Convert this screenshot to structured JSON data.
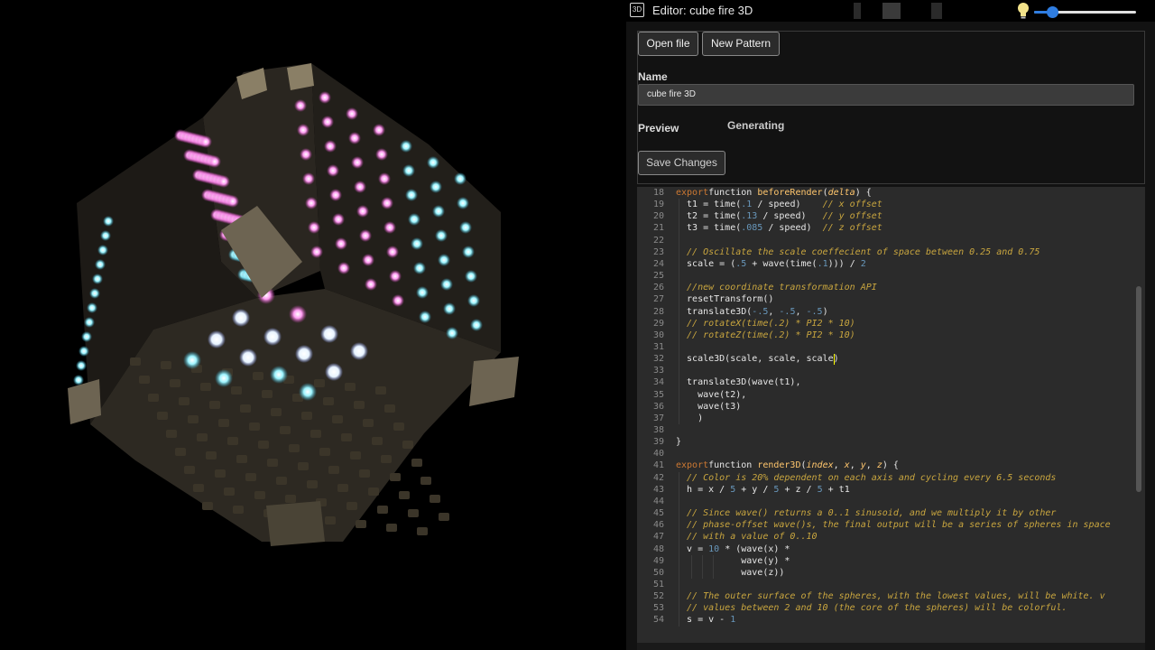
{
  "titlebar": {
    "app_icon_text": "3D",
    "title": "Editor: cube fire 3D",
    "bulb_icon": "lightbulb-icon",
    "brightness_fraction": 0.18
  },
  "toolbar": {
    "open_file_label": "Open file",
    "new_pattern_label": "New Pattern"
  },
  "form": {
    "name_label": "Name",
    "name_value": "cube fire 3D",
    "preview_label": "Preview",
    "preview_status": "Generating",
    "save_label": "Save Changes"
  },
  "code": {
    "line_numbers": [
      "18",
      "19",
      "20",
      "21",
      "22",
      "23",
      "24",
      "25",
      "26",
      "27",
      "28",
      "29",
      "30",
      "31",
      "32",
      "33",
      "34",
      "35",
      "36",
      "37",
      "38",
      "39",
      "40",
      "41",
      "42",
      "43",
      "44",
      "45",
      "46",
      "47",
      "48",
      "49",
      "50",
      "51",
      "52",
      "53",
      "54"
    ],
    "lines": [
      [
        [
          "kw",
          "export"
        ],
        [
          "",
          "function "
        ],
        [
          "fn",
          "beforeRender"
        ],
        [
          "",
          "("
        ],
        [
          "arg",
          "delta"
        ],
        [
          "",
          ") {"
        ]
      ],
      [
        [
          "",
          "  t1 = time("
        ],
        [
          "num",
          ".1"
        ],
        [
          "",
          ""
        ],
        [
          "",
          ""
        ],
        [
          "",
          ""
        ],
        [
          "",
          ""
        ],
        [
          "",
          ""
        ],
        [
          "",
          ""
        ],
        [
          "",
          ""
        ],
        [
          "",
          ""
        ],
        [
          "",
          ""
        ],
        [
          "",
          ""
        ],
        [
          "",
          ""
        ],
        [
          "",
          ""
        ],
        [
          "",
          ""
        ],
        [
          "",
          ""
        ],
        [
          "",
          ""
        ],
        [
          "",
          ""
        ],
        [
          "",
          ""
        ],
        [
          "",
          ""
        ],
        [
          "",
          ""
        ],
        [
          "",
          ""
        ],
        [
          "",
          ""
        ],
        [
          "",
          ""
        ],
        [
          "",
          ""
        ],
        [
          "",
          ""
        ],
        [
          "",
          ""
        ],
        [
          "",
          ""
        ],
        [
          "",
          ""
        ],
        [
          "",
          ""
        ],
        [
          "",
          ""
        ],
        [
          "",
          ""
        ],
        [
          "",
          ""
        ],
        [
          "",
          ""
        ],
        [
          "",
          ""
        ],
        [
          "",
          ""
        ],
        [
          "",
          ""
        ],
        [
          "",
          ""
        ],
        [
          "",
          ""
        ],
        [
          "",
          ""
        ],
        [
          "",
          ""
        ],
        [
          "",
          ""
        ],
        [
          "",
          ""
        ],
        [
          "",
          ""
        ],
        [
          "",
          ""
        ],
        [
          "",
          ""
        ],
        [
          "",
          ""
        ],
        [
          "",
          ""
        ],
        [
          "",
          ""
        ],
        [
          "",
          ""
        ],
        [
          "",
          ""
        ],
        [
          "",
          ""
        ],
        [
          "",
          ""
        ],
        [
          "",
          ""
        ],
        [
          "",
          ""
        ],
        [
          "",
          ""
        ],
        [
          "",
          ""
        ],
        [
          "",
          ""
        ],
        [
          "",
          ""
        ],
        [
          "",
          ""
        ],
        [
          "",
          ""
        ],
        [
          "",
          ""
        ],
        [
          "",
          ""
        ],
        [
          "",
          ""
        ],
        [
          "",
          ""
        ],
        [
          "",
          ""
        ],
        [
          "",
          ""
        ],
        [
          "",
          ""
        ],
        [
          "",
          ""
        ],
        [
          "",
          ""
        ],
        [
          "",
          ""
        ],
        [
          "",
          ""
        ],
        [
          "",
          ""
        ],
        [
          "",
          ""
        ],
        [
          "",
          ""
        ],
        [
          "",
          ""
        ],
        [
          "",
          ""
        ],
        [
          "",
          ""
        ],
        [
          "",
          ""
        ],
        [
          "",
          ""
        ],
        [
          "",
          ""
        ],
        [
          "",
          ""
        ],
        [
          "",
          ""
        ],
        [
          "",
          ""
        ],
        [
          "",
          ""
        ],
        [
          "",
          ""
        ],
        [
          "",
          ""
        ],
        [
          "",
          ""
        ],
        [
          "",
          ""
        ],
        [
          "",
          ""
        ],
        [
          "",
          ""
        ],
        [
          "",
          ""
        ],
        [
          "",
          ""
        ],
        [
          "",
          ""
        ],
        [
          "",
          ""
        ],
        [
          "",
          ""
        ],
        [
          "",
          ""
        ],
        [
          "",
          ""
        ],
        [
          "",
          ""
        ],
        [
          "",
          ""
        ],
        [
          "",
          ""
        ],
        [
          "",
          ""
        ],
        [
          "",
          ""
        ],
        [
          "",
          ""
        ],
        [
          "",
          ""
        ],
        [
          "",
          ""
        ],
        [
          "",
          ""
        ],
        [
          "",
          ""
        ],
        [
          "",
          " / speed)    "
        ],
        [
          "cm",
          "// x offset"
        ]
      ],
      [
        [
          "",
          "  t2 = time("
        ],
        [
          "num",
          ".13"
        ],
        [
          "",
          " / speed)   "
        ],
        [
          "cm",
          "// y offset"
        ]
      ],
      [
        [
          "",
          "  t3 = time("
        ],
        [
          "num",
          ".085"
        ],
        [
          "",
          " / speed)  "
        ],
        [
          "cm",
          "// z offset"
        ]
      ],
      [],
      [
        [
          "cm",
          "  // Oscillate the scale coeffecient of space between 0.25 and 0.75"
        ]
      ],
      [
        [
          "",
          "  scale = ("
        ],
        [
          "num",
          ".5"
        ],
        [
          "",
          " + wave(time("
        ],
        [
          "num",
          ".1"
        ],
        [
          "",
          "))) / "
        ],
        [
          "num",
          "2"
        ]
      ],
      [],
      [
        [
          "cm",
          "  //new coordinate transformation API"
        ]
      ],
      [
        [
          "",
          "  resetTransform()"
        ]
      ],
      [
        [
          "",
          "  translate3D("
        ],
        [
          "num",
          "-.5"
        ],
        [
          "",
          ", "
        ],
        [
          "num",
          "-.5"
        ],
        [
          "",
          ", "
        ],
        [
          "num",
          "-.5"
        ],
        [
          "",
          ")"
        ]
      ],
      [
        [
          "cm",
          "  // rotateX(time(.2) * PI2 * 10)"
        ]
      ],
      [
        [
          "cm",
          "  // rotateZ(time(.2) * PI2 * 10)"
        ]
      ],
      [],
      [
        [
          "",
          "  scale3D(scale, scale, scale)"
        ]
      ],
      [],
      [
        [
          "",
          "  translate3D(wave(t1),"
        ]
      ],
      [
        [
          "",
          "    wave(t2),"
        ]
      ],
      [
        [
          "",
          "    wave(t3)"
        ]
      ],
      [
        [
          "",
          "    )"
        ]
      ],
      [],
      [
        [
          "",
          "}"
        ]
      ],
      [],
      [
        [
          "kw",
          "export"
        ],
        [
          "",
          "function "
        ],
        [
          "fn",
          "render3D"
        ],
        [
          "",
          "("
        ],
        [
          "arg",
          "index"
        ],
        [
          "",
          ", "
        ],
        [
          "arg",
          "x"
        ],
        [
          "",
          ", "
        ],
        [
          "arg",
          "y"
        ],
        [
          "",
          ", "
        ],
        [
          "arg",
          "z"
        ],
        [
          "",
          ") {"
        ]
      ],
      [
        [
          "cm",
          "  // Color is 20% dependent on each axis and cycling every 6.5 seconds"
        ]
      ],
      [
        [
          "",
          "  h = x / "
        ],
        [
          "num",
          "5"
        ],
        [
          "",
          " + y / "
        ],
        [
          "num",
          "5"
        ],
        [
          "",
          " + z / "
        ],
        [
          "num",
          "5"
        ],
        [
          "",
          " + t1"
        ]
      ],
      [],
      [
        [
          "cm",
          "  // Since wave() returns a 0..1 sinusoid, and we multiply it by other"
        ]
      ],
      [
        [
          "cm",
          "  // phase-offset wave()s, the final output will be a series of spheres in space"
        ]
      ],
      [
        [
          "cm",
          "  // with a value of 0..10"
        ]
      ],
      [
        [
          "",
          "  v = "
        ],
        [
          "num",
          "10"
        ],
        [
          "",
          " * (wave(x) *"
        ]
      ],
      [
        [
          "",
          "            wave(y) *"
        ]
      ],
      [
        [
          "",
          "            wave(z))"
        ]
      ],
      [],
      [
        [
          "cm",
          "  // The outer surface of the spheres, with the lowest values, will be white. v"
        ]
      ],
      [
        [
          "cm",
          "  // values between 2 and 10 (the core of the spheres) will be colorful."
        ]
      ],
      [
        [
          "",
          "  s = v - "
        ],
        [
          "num",
          "1"
        ]
      ]
    ]
  },
  "colors": {
    "accent": "#2f7de1",
    "code_bg": "#2b2b2b",
    "keyword": "#cc7832",
    "function": "#ffc66d",
    "number": "#6897bb",
    "comment": "#c9a63f"
  }
}
